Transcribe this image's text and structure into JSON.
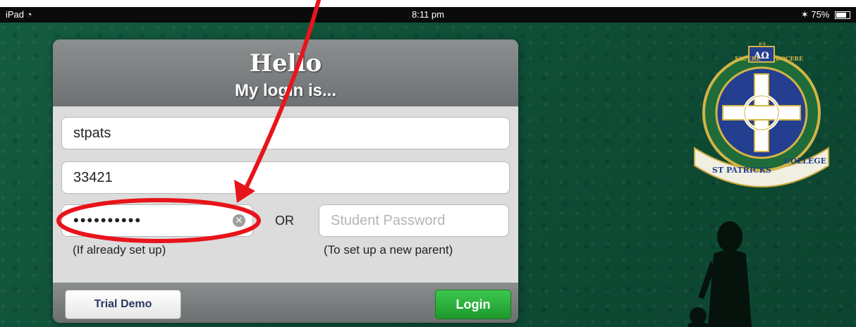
{
  "status_bar": {
    "device": "iPad",
    "time": "8:11 pm",
    "battery": "75%",
    "battery_level": 0.75
  },
  "login_panel": {
    "greeting": "Hello",
    "subtitle": "My login is...",
    "school_code": "stpats",
    "id_value": "33421",
    "parent_password_masked": "••••••••••",
    "or_label": "OR",
    "student_password_placeholder": "Student Password",
    "hint_left": "(If already set up)",
    "hint_right": "(To set up a new parent)",
    "trial_button": "Trial Demo",
    "login_button": "Login"
  },
  "crest": {
    "motto_1": "FACERE",
    "motto_2": "ET",
    "motto_3": "DOCERE",
    "alpha_omega": "AΩ",
    "banner_left": "ST PATRICKS",
    "banner_right": "COLLEGE"
  },
  "colors": {
    "background": "#0f4a34",
    "login_button": "#22a533",
    "annotation": "#e8141b"
  }
}
